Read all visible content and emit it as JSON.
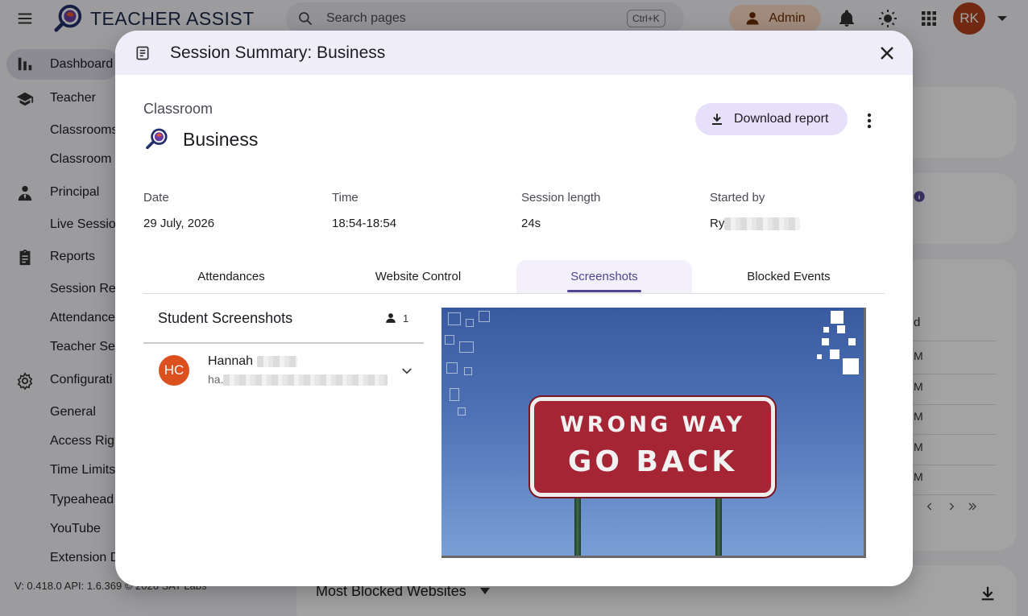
{
  "app": {
    "brand": "TEACHER ASSIST",
    "search_placeholder": "Search pages",
    "search_shortcut": "Ctrl+K",
    "admin_label": "Admin",
    "avatar_initials": "RK",
    "version_text": "V: 0.418.0   API: 1.6.369   © 2026 SAT Labs"
  },
  "sidebar": {
    "items": [
      {
        "label": "Dashboard",
        "icon": "bar-chart-icon"
      },
      {
        "label": "Teacher",
        "icon": "school-icon"
      },
      {
        "label": "Classrooms",
        "icon": ""
      },
      {
        "label": "Classroom",
        "icon": ""
      },
      {
        "label": "Principal",
        "icon": "person-tie-icon"
      },
      {
        "label": "Live Sessio",
        "icon": ""
      },
      {
        "label": "Reports",
        "icon": "clipboard-icon"
      },
      {
        "label": "Session Re",
        "icon": ""
      },
      {
        "label": "Attendance",
        "icon": ""
      },
      {
        "label": "Teacher Se",
        "icon": ""
      },
      {
        "label": "Configurati",
        "icon": "gear-icon"
      },
      {
        "label": "General",
        "icon": ""
      },
      {
        "label": "Access Rig",
        "icon": ""
      },
      {
        "label": "Time Limits",
        "icon": ""
      },
      {
        "label": "Typeahead",
        "icon": ""
      },
      {
        "label": "YouTube",
        "icon": ""
      },
      {
        "label": "Extension D",
        "icon": ""
      }
    ]
  },
  "background": {
    "rows": [
      "d",
      "M",
      "M",
      "M",
      "M",
      "M"
    ],
    "bottom_title": "Most Blocked Websites"
  },
  "modal": {
    "title": "Session Summary: Business",
    "classroom_label": "Classroom",
    "classroom_name": "Business",
    "download_label": "Download report",
    "info": {
      "date_label": "Date",
      "date_value": "29 July, 2026",
      "time_label": "Time",
      "time_value": "18:54-18:54",
      "length_label": "Session length",
      "length_value": "24s",
      "started_label": "Started by",
      "started_value": "Ry"
    },
    "tabs": [
      "Attendances",
      "Website Control",
      "Screenshots",
      "Blocked Events"
    ],
    "active_tab": "Screenshots",
    "list": {
      "title": "Student Screenshots",
      "count": "1",
      "students": [
        {
          "initials": "HC",
          "name": "Hannah",
          "email": "ha."
        }
      ]
    },
    "screenshot": {
      "sign_line1": "WRONG WAY",
      "sign_line2": "GO BACK"
    }
  },
  "colors": {
    "accent": "#4e4690",
    "download_bg": "#e7e0fb",
    "admin_bg": "#fbd9c4",
    "avatar_rk": "#b3401c",
    "avatar_hc": "#dc4f1e"
  }
}
